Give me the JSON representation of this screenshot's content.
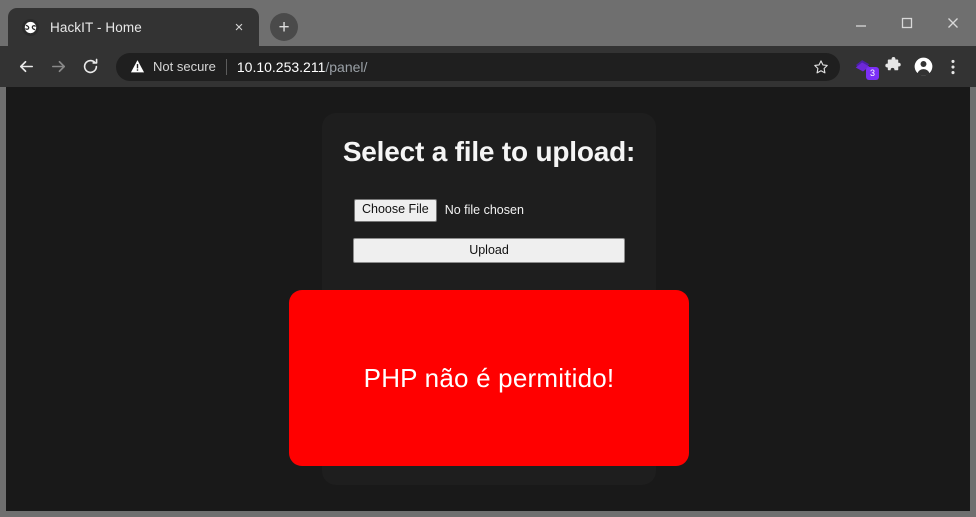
{
  "window": {
    "controls": {
      "minimize": "minimize",
      "maximize": "maximize",
      "close": "close"
    }
  },
  "browser": {
    "tab": {
      "title": "HackIT - Home",
      "favicon": "globe-icon",
      "close_label": "×"
    },
    "new_tab_label": "+",
    "nav": {
      "back": "back-arrow",
      "forward": "forward-arrow",
      "reload": "reload-icon"
    },
    "omnibox": {
      "security_label": "Not secure",
      "security_icon": "warning-triangle-icon",
      "url_host": "10.10.253.211",
      "url_path": "/panel/",
      "bookmark_icon": "star-icon"
    },
    "toolbar_icons": {
      "extension_label": "extension-icon",
      "extension_badge": "3",
      "puzzle_label": "extensions-puzzle-icon",
      "profile_label": "profile-avatar-icon",
      "menu_label": "three-dot-menu-icon"
    }
  },
  "page": {
    "heading": "Select a file to upload:",
    "file_input": {
      "button_label": "Choose File",
      "status_text": "No file chosen"
    },
    "upload_button_label": "Upload",
    "alert": {
      "message": "PHP não é permitido!",
      "background_color": "#ff0000",
      "text_color": "#ffffff"
    },
    "background_color": "#191919",
    "panel_color": "#1e1e1e"
  }
}
